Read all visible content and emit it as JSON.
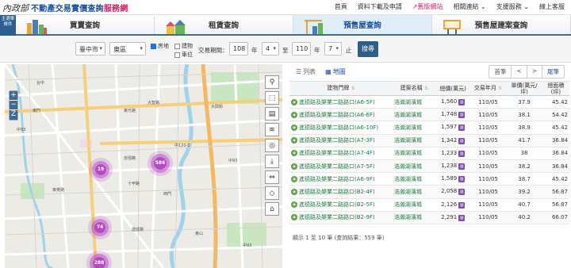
{
  "header": {
    "logo_text": "內政部",
    "title_main": "不動產交易實價查詢",
    "title_highlight": "服務網",
    "nav": [
      "首頁",
      "資料下載及申請",
      "舊版網站",
      "相關連結",
      "支援服務",
      "線上客服"
    ]
  },
  "tabs": {
    "side": "主選單條件",
    "items": [
      "買賣查詢",
      "租賃查詢",
      "預售屋查詢",
      "預售屋建案查詢"
    ]
  },
  "filter": {
    "city": "臺中市",
    "district": "東區",
    "cb_house": "房地",
    "cb_building": "建物",
    "cb_parking": "車位",
    "period_label": "交易期間：",
    "year_from": "108",
    "year_unit": "年",
    "month_from": "4",
    "to_label": "至",
    "year_to": "110",
    "month_to": "7",
    "end_label": "止",
    "search": "搜尋"
  },
  "map": {
    "clusters": [
      "19",
      "586",
      "74",
      "288"
    ],
    "labels": [
      "中120-1",
      "中93",
      "中93",
      "中93",
      "自強路",
      "十甲路",
      "東英路",
      "東光路",
      "大智路",
      "建成路",
      "東門",
      "台中",
      "大興街",
      "西門",
      "東山"
    ]
  },
  "results": {
    "view_list": "列表",
    "view_map": "地圖",
    "pager": [
      "首筆",
      "<",
      ">",
      "尾筆"
    ],
    "headers": [
      "建物門牌",
      "建案名稱",
      "總價(萬元)",
      "交易年月",
      "單價(萬元/坪)",
      "總面積(坪)"
    ],
    "rows": [
      {
        "addr": "進德路及樂業二路路口(A6-5F)",
        "name": "浩瀚湖濱城",
        "price": "1,560",
        "date": "110/05",
        "unit": "37.9",
        "area": "45.42"
      },
      {
        "addr": "進德路及樂業二路路口(A6-6F)",
        "name": "浩瀚湖濱城",
        "price": "1,748",
        "date": "110/05",
        "unit": "38.1",
        "area": "54.42"
      },
      {
        "addr": "進德路及樂業二路路口(A6-10F)",
        "name": "浩瀚湖濱城",
        "price": "1,597",
        "date": "110/05",
        "unit": "38.9",
        "area": "45.42"
      },
      {
        "addr": "進德路及樂業二路路口(A7-3F)",
        "name": "浩瀚湖濱城",
        "price": "1,342",
        "date": "110/05",
        "unit": "41.7",
        "area": "36.84"
      },
      {
        "addr": "進德路及樂業二路路口(A7-4F)",
        "name": "浩瀚湖濱城",
        "price": "1,233",
        "date": "110/05",
        "unit": "38",
        "area": "36.84"
      },
      {
        "addr": "進德路及樂業二路路口(A7-5F)",
        "name": "浩瀚湖濱城",
        "price": "1,238",
        "date": "110/05",
        "unit": "38.2",
        "area": "36.84"
      },
      {
        "addr": "進德路及樂業二路路口(A6-9F)",
        "name": "浩瀚湖濱城",
        "price": "1,589",
        "date": "110/05",
        "unit": "38.7",
        "area": "45.42"
      },
      {
        "addr": "進德路及樂業二路路口(B2-4F)",
        "name": "浩瀚湖濱城",
        "price": "2,058",
        "date": "110/05",
        "unit": "39.2",
        "area": "56.87"
      },
      {
        "addr": "進德路及樂業二路路口(B2-5F)",
        "name": "浩瀚湖濱城",
        "price": "2,126",
        "date": "110/05",
        "unit": "40.7",
        "area": "56.87"
      },
      {
        "addr": "進德路及樂業二路路口(B2-9F)",
        "name": "浩瀚湖濱城",
        "price": "2,291",
        "date": "110/05",
        "unit": "40.2",
        "area": "66.07"
      }
    ],
    "footer": "顯示 1 至 10 筆 (查詢結果：559 筆)"
  },
  "colors": {
    "brand": "#1a4f9c",
    "accent": "#d31d6a",
    "cluster": "#b63fc5",
    "river": "#9fd3ec",
    "button": "#2d5e8a"
  }
}
